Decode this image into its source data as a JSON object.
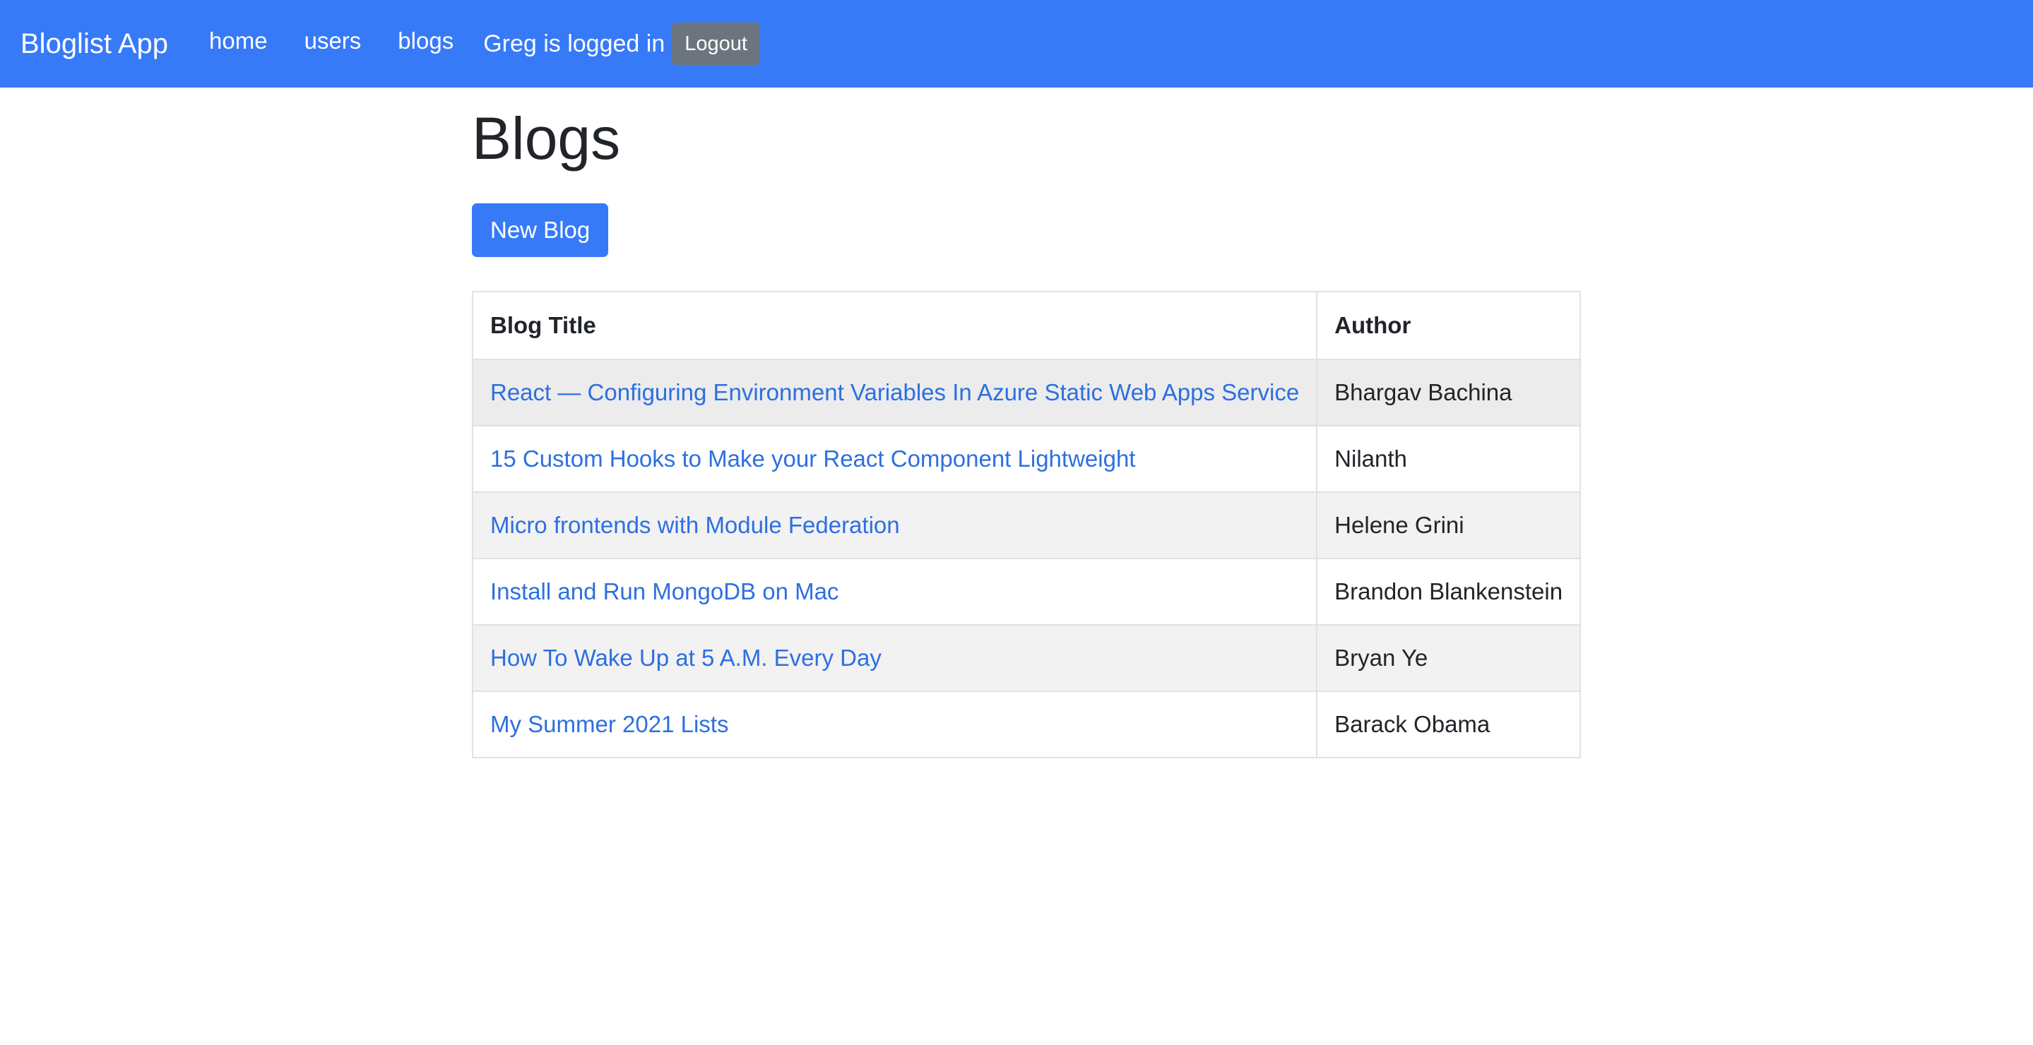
{
  "navbar": {
    "brand": "Bloglist App",
    "links": [
      "home",
      "users",
      "blogs"
    ],
    "login_status": "Greg is logged in",
    "logout_label": "Logout"
  },
  "page": {
    "title": "Blogs",
    "new_blog_label": "New Blog"
  },
  "table": {
    "headers": [
      "Blog Title",
      "Author"
    ],
    "rows": [
      {
        "title": "React — Configuring Environment Variables In Azure Static Web Apps Service",
        "author": "Bhargav Bachina"
      },
      {
        "title": "15 Custom Hooks to Make your React Component Lightweight",
        "author": "Nilanth"
      },
      {
        "title": "Micro frontends with Module Federation",
        "author": "Helene Grini"
      },
      {
        "title": "Install and Run MongoDB on Mac",
        "author": "Brandon Blankenstein"
      },
      {
        "title": "How To Wake Up at 5 A.M. Every Day",
        "author": "Bryan Ye"
      },
      {
        "title": "My Summer 2021 Lists",
        "author": "Barack Obama"
      }
    ]
  },
  "colors": {
    "primary": "#377af8",
    "secondary": "#6c757d",
    "link": "#2d6fe0",
    "stripe": "#f2f2f2"
  }
}
